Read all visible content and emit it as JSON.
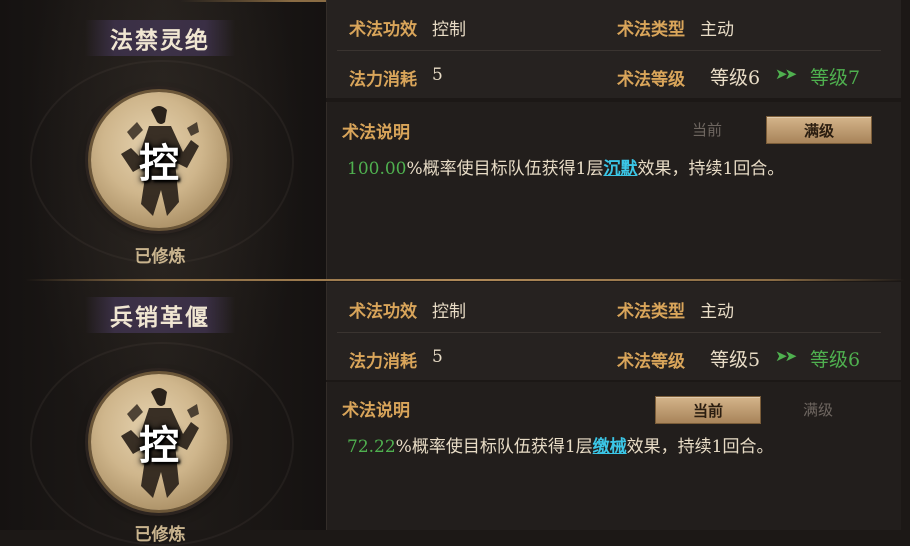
{
  "skills": [
    {
      "name": "法禁灵绝",
      "badge_char": "控",
      "status": "已修炼",
      "stats": {
        "effect_label": "术法功效",
        "effect_value": "控制",
        "type_label": "术法类型",
        "type_value": "主动",
        "cost_label": "法力消耗",
        "cost_value": "5",
        "level_label": "术法等级",
        "level_current": "等级6",
        "level_arrow": "➤➤",
        "level_next": "等级7"
      },
      "description": {
        "title": "术法说明",
        "tab_current": "当前",
        "tab_max": "满级",
        "active_tab": "max",
        "percent": "100.00",
        "text_before": "%概率使目标队伍获得1层",
        "effect_name": "沉默",
        "text_after": "效果，持续1回合。"
      }
    },
    {
      "name": "兵销革偃",
      "badge_char": "控",
      "status": "已修炼",
      "stats": {
        "effect_label": "术法功效",
        "effect_value": "控制",
        "type_label": "术法类型",
        "type_value": "主动",
        "cost_label": "法力消耗",
        "cost_value": "5",
        "level_label": "术法等级",
        "level_current": "等级5",
        "level_arrow": "➤➤",
        "level_next": "等级6"
      },
      "description": {
        "title": "术法说明",
        "tab_current": "当前",
        "tab_max": "满级",
        "active_tab": "current",
        "percent": "72.22",
        "text_before": "%概率使目标队伍获得1层",
        "effect_name": "缴械",
        "text_after": "效果，持续1回合。"
      }
    }
  ],
  "colors": {
    "accent_label": "#d9a55a",
    "level_up_green": "#4fb04f",
    "effect_link": "#3bc6e6",
    "active_tab_bg": "#c8a678"
  },
  "icons": {
    "medallion": "warrior-silhouette-icon",
    "level_arrow": "double-chevron-right-icon"
  }
}
